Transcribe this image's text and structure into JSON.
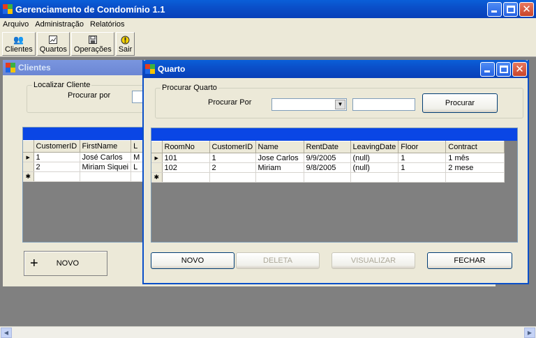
{
  "app": {
    "title": "Gerenciamento de Condomínio 1.1"
  },
  "menu": [
    "Arquivo",
    "Administração",
    "Relatórios"
  ],
  "toolbar": [
    {
      "label": "Clientes",
      "icon": "people-icon"
    },
    {
      "label": "Quartos",
      "icon": "chart-icon"
    },
    {
      "label": "Operações",
      "icon": "disk-icon"
    },
    {
      "label": "Sair",
      "icon": "exit-icon"
    }
  ],
  "clientes": {
    "title": "Clientes",
    "group_label": "Localizar Cliente",
    "search_label": "Procurar por",
    "columns": [
      "CustomerID",
      "FirstName",
      "L"
    ],
    "rows": [
      [
        "1",
        "José Carlos",
        "M"
      ],
      [
        "2",
        "Miriam Siquei",
        "L"
      ]
    ],
    "novo_label": "NOVO",
    "novo_glyph": "+"
  },
  "quarto": {
    "title": "Quarto",
    "group_label": "Procurar Quarto",
    "search_label": "Procurar Por",
    "combo_value": "",
    "search_value": "",
    "procurar_label": "Procurar",
    "columns": [
      "RoomNo",
      "CustomerID",
      "Name",
      "RentDate",
      "LeavingDate",
      "Floor",
      "Contract"
    ],
    "rows": [
      [
        "101",
        "1",
        "Jose Carlos",
        "9/9/2005",
        "(null)",
        "1",
        "1 mês"
      ],
      [
        "102",
        "2",
        "Miriam",
        "9/8/2005",
        "(null)",
        "1",
        "2 mese"
      ]
    ],
    "buttons": {
      "novo": "NOVO",
      "deleta": "DELETA",
      "visualizar": "VISUALIZAR",
      "fechar": "FECHAR"
    }
  },
  "grid_glyphs": {
    "current_row": "▶",
    "new_row": "✱"
  }
}
